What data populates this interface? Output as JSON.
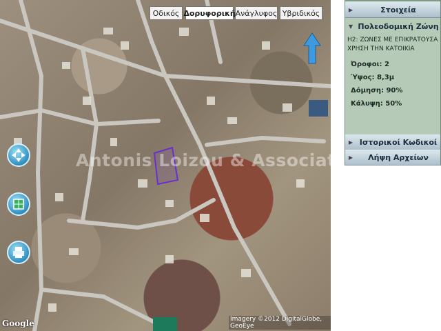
{
  "map": {
    "type_buttons": [
      "Οδικός",
      "Δορυφορική",
      "Ανάγλυφος",
      "Υβριδικός"
    ],
    "active_type": "Δορυφορική",
    "watermark": "Antonis Loizou & Associates",
    "google_logo": "Google",
    "imagery_credit": "Imagery ©2012 DigitalGlobe, GeoEye",
    "controls": [
      "navigation-control",
      "layers-control",
      "print-control"
    ]
  },
  "panel": {
    "sections": [
      {
        "label": "Στοιχεία",
        "expanded": false
      },
      {
        "label": "Πολεοδομική Ζώνη",
        "expanded": true
      },
      {
        "label": "Ιστορικοί Κωδικοί",
        "expanded": false
      },
      {
        "label": "Λήψη Αρχείων",
        "expanded": false
      }
    ],
    "zone": {
      "description": "H2: ΖΩΝΕΣ ΜΕ ΕΠΙΚΡΑΤΟΥΣΑ ΧΡΗΣΗ ΤΗΝ ΚΑΤΟΙΚΙΑ",
      "floors": "Όροφοι: 2",
      "height": "Ύψος: 8,3μ",
      "density": "Δόμηση: 90%",
      "coverage": "Κάλυψη: 50%"
    }
  },
  "colors": {
    "panel_bg": "#b5cbb7",
    "parcel_outline": "#6a2fd0",
    "control_blue": "#2f8fc0"
  }
}
